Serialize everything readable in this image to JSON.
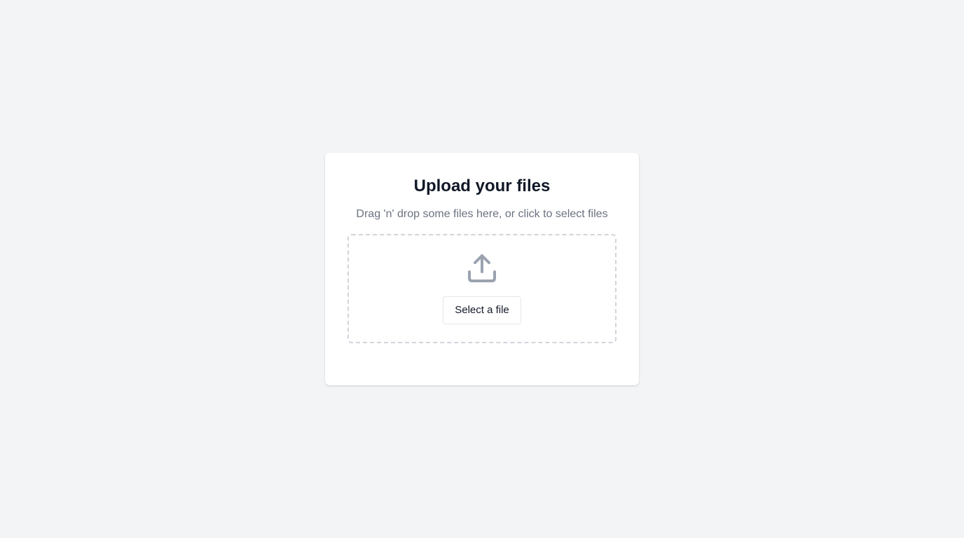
{
  "upload": {
    "title": "Upload your files",
    "subtitle": "Drag 'n' drop some files here, or click to select files",
    "icon": "upload-icon",
    "button_label": "Select a file"
  },
  "colors": {
    "background": "#f3f4f6",
    "card": "#ffffff",
    "title": "#111827",
    "subtitle": "#6b7280",
    "icon": "#9ca3af",
    "dropzone_border": "#d1d5db"
  }
}
